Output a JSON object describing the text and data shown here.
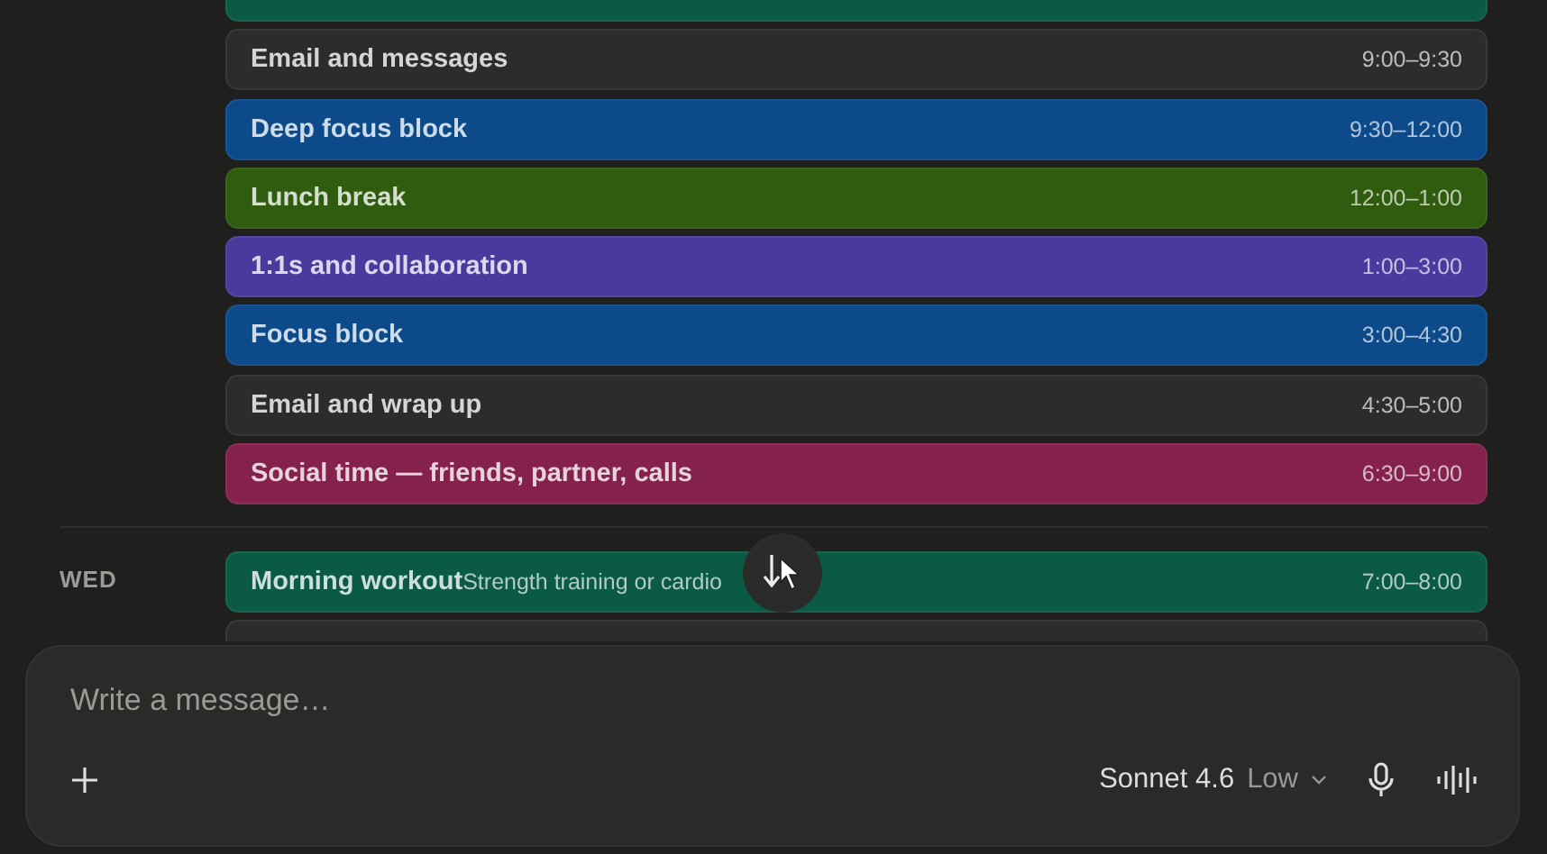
{
  "days": [
    {
      "events": [
        {
          "kind": "cut",
          "color": "#0b5a46"
        },
        {
          "kind": "event",
          "title": "Email and messages",
          "time": "9:00–9:30",
          "color": "#2c2c2a"
        },
        {
          "kind": "event",
          "title": "Deep focus block",
          "time": "9:30–12:00",
          "color": "#0c4a8a"
        },
        {
          "kind": "event",
          "title": "Lunch break",
          "time": "12:00–1:00",
          "color": "#2f5c0e"
        },
        {
          "kind": "event",
          "title": "1:1s and collaboration",
          "time": "1:00–3:00",
          "color": "#4b3a9e"
        },
        {
          "kind": "event",
          "title": "Focus block",
          "time": "3:00–4:30",
          "color": "#0c4a8a"
        },
        {
          "kind": "event",
          "title": "Email and wrap up",
          "time": "4:30–5:00",
          "color": "#2c2c2a"
        },
        {
          "kind": "event",
          "title": "Social time — friends, partner, calls",
          "time": "6:30–9:00",
          "color": "#84214c"
        }
      ]
    },
    {
      "label": "WED",
      "events": [
        {
          "kind": "event",
          "title": "Morning workout",
          "note": "Strength training or cardio",
          "time": "7:00–8:00",
          "color": "#0b5a46"
        },
        {
          "kind": "cut",
          "color": "#2c2c2a"
        }
      ]
    }
  ],
  "composer": {
    "placeholder": "Write a message…",
    "model": "Sonnet 4.6",
    "effort": "Low"
  }
}
